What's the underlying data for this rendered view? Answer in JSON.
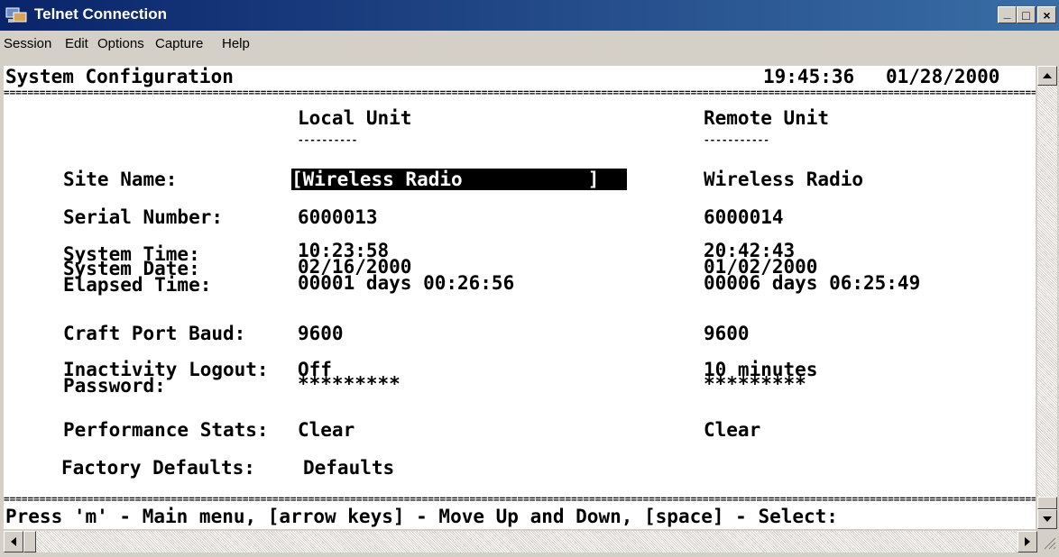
{
  "window": {
    "title": "Telnet Connection",
    "controls": {
      "minimize": "_",
      "maximize": "□",
      "close": "×"
    }
  },
  "menu": {
    "items": [
      "Session",
      "Edit",
      "Options",
      "Capture",
      "Help"
    ]
  },
  "screen": {
    "header_title": "System Configuration",
    "time": "19:45:36",
    "date": "01/28/2000",
    "col_local": "Local Unit",
    "col_remote": "Remote Unit",
    "underline_local": "----------",
    "underline_remote": "-----------",
    "fields": {
      "site_name": {
        "label": "Site Name:",
        "local": "[Wireless Radio           ]",
        "remote": "Wireless Radio"
      },
      "serial": {
        "label": "Serial Number:",
        "local": "6000013",
        "remote": "6000014"
      },
      "system_time": {
        "label": "System Time:",
        "local": "10:23:58",
        "remote": "20:42:43"
      },
      "system_date": {
        "label": "System Date:",
        "local": "02/16/2000",
        "remote": "01/02/2000"
      },
      "elapsed": {
        "label": "Elapsed Time:",
        "local": "00001 days 00:26:56",
        "remote": "00006 days 06:25:49"
      },
      "baud": {
        "label": "Craft Port Baud:",
        "local": "9600",
        "remote": "9600"
      },
      "inactivity": {
        "label": "Inactivity Logout:",
        "local": "Off",
        "remote": "10 minutes"
      },
      "password": {
        "label": "Password:",
        "local": "*********",
        "remote": "*********"
      },
      "perf": {
        "label": "Performance Stats:",
        "local": "Clear",
        "remote": "Clear"
      },
      "factory": {
        "label": "Factory Defaults:",
        "local": "Defaults"
      }
    },
    "footer_hint": "Press 'm' - Main menu, [arrow keys] - Move Up and Down, [space] - Select:"
  },
  "colors": {
    "titlebar": "#0a246a",
    "terminal_bg": "#ffffff",
    "text": "#000000",
    "highlight_bg": "#000000"
  }
}
